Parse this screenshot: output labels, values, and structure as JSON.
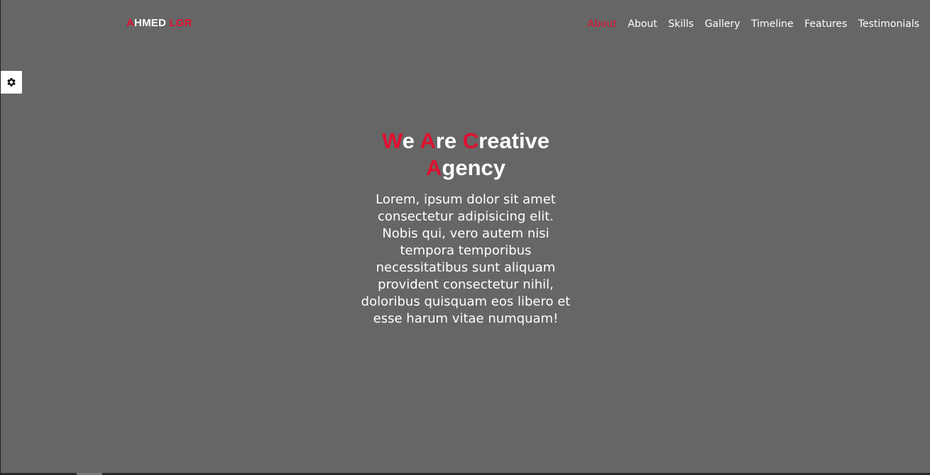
{
  "logo": {
    "first_letter": "A",
    "rest_first_word": "HMED",
    "second_word": "LGR"
  },
  "nav": {
    "items": [
      "About",
      "About",
      "Skills",
      "Gallery",
      "Timeline",
      "Features",
      "Testimonials"
    ]
  },
  "settings": {
    "icon": "gear-icon"
  },
  "hero": {
    "title_parts": {
      "w1_first": "W",
      "w1_rest": "e",
      "w2_first": "A",
      "w2_rest": "re",
      "w3_first": "C",
      "w3_rest": "reative",
      "w4_first": "A",
      "w4_rest": "gency"
    },
    "text": "Lorem, ipsum dolor sit amet consectetur adipisicing elit. Nobis qui, vero autem nisi tempora temporibus necessitatibus sunt aliquam provident consectetur nihil, doloribus quisquam eos libero et esse harum vitae numquam!"
  },
  "colors": {
    "accent": "#e0102f",
    "background": "#666666",
    "text": "#ffffff"
  }
}
